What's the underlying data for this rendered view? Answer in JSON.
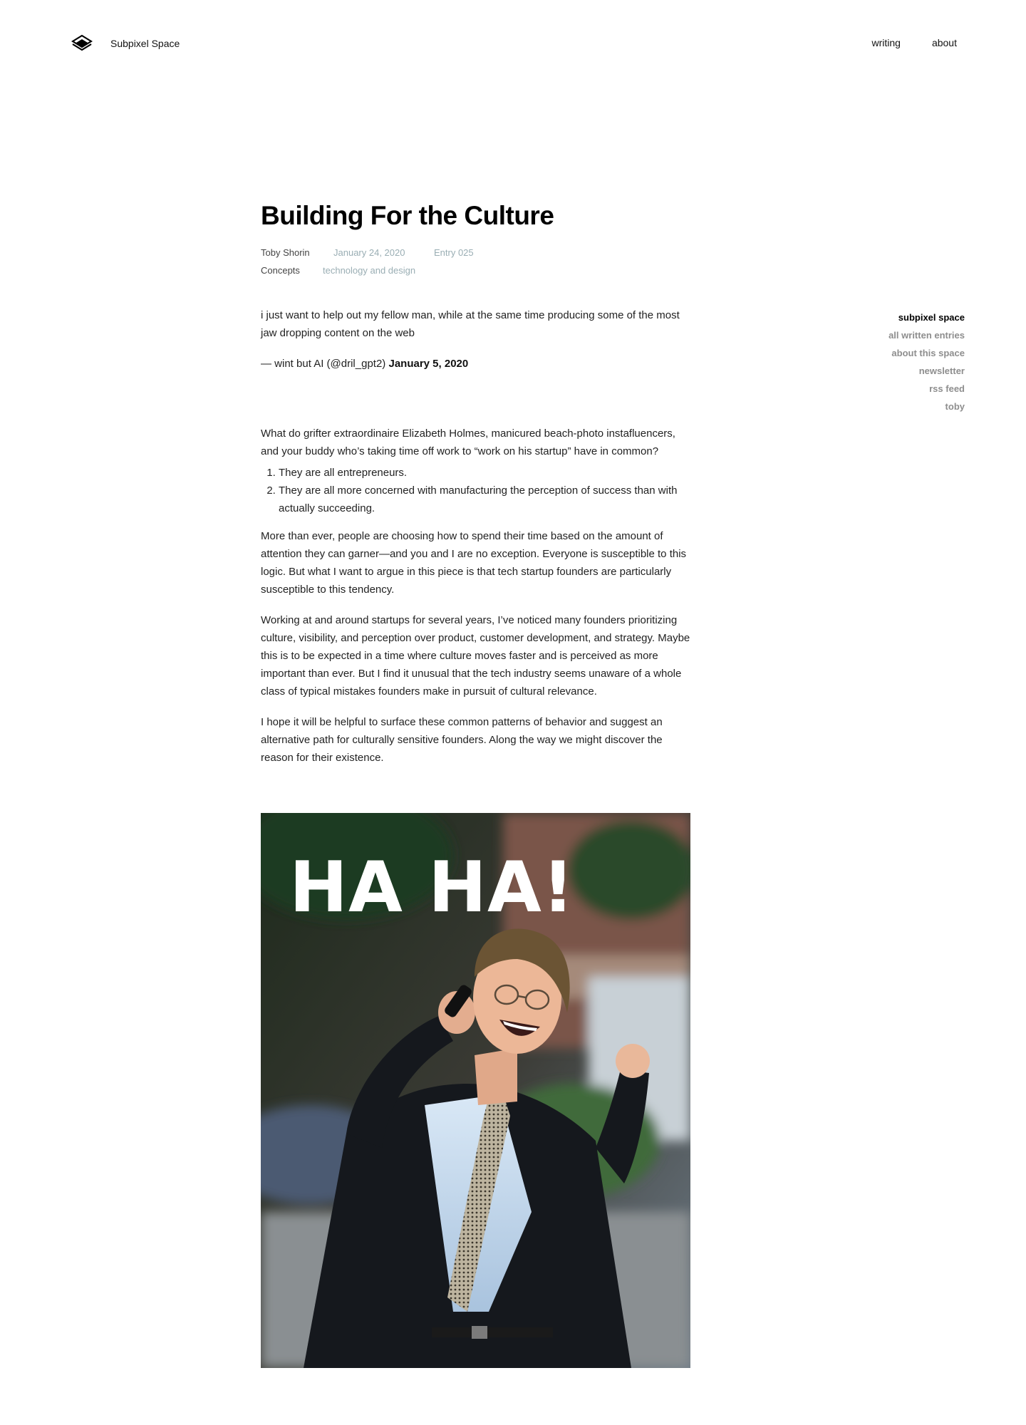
{
  "site": {
    "name": "Subpixel Space"
  },
  "nav": {
    "items": [
      {
        "label": "writing"
      },
      {
        "label": "about"
      }
    ]
  },
  "article": {
    "title": "Building For the Culture",
    "author": "Toby Shorin",
    "date": "January 24, 2020",
    "entry": "Entry 025",
    "category": "Concepts",
    "tag": "technology and design",
    "epigraph": {
      "quote": "i just want to help out my fellow man, while at the same time producing some of the most jaw dropping content on the web",
      "attribution": "— wint but AI (@dril_gpt2)",
      "date": "January 5, 2020"
    },
    "paragraphs": [
      "What do grifter extraordinaire Elizabeth Holmes, manicured beach-photo instafluencers, and your buddy who’s taking time off work to “work on his startup” have in common?",
      "More than ever, people are choosing how to spend their time based on the amount of attention they can garner—and you and I are no exception. Everyone is susceptible to this logic. But what I want to argue in this piece is that tech startup founders are particularly susceptible to this tendency.",
      "Working at and around startups for several years, I’ve noticed many founders prioritizing culture, visibility, and perception over product, customer development, and strategy. Maybe this is to be expected in a time where culture moves faster and is perceived as more important than ever. But I find it unusual that the tech industry seems unaware of a whole class of typical mistakes founders make in pursuit of cultural relevance.",
      "I hope it will be helpful to surface these common patterns of behavior and suggest an alternative path for culturally sensitive founders. Along the way we might discover the reason for their existence."
    ],
    "list": [
      "They are all entrepreneurs.",
      "They are all more concerned with manufacturing the perception of success than with actually succeeding."
    ],
    "image": {
      "caption_text": "HA HA!"
    }
  },
  "sidebar": {
    "items": [
      {
        "label": "subpixel space"
      },
      {
        "label": "all written entries"
      },
      {
        "label": "about this space"
      },
      {
        "label": "newsletter"
      },
      {
        "label": "rss feed"
      },
      {
        "label": "toby"
      }
    ]
  },
  "colors": {
    "muted": "#9aaeb4",
    "sidebar_inactive": "#8e8e8e",
    "text": "#222222"
  }
}
